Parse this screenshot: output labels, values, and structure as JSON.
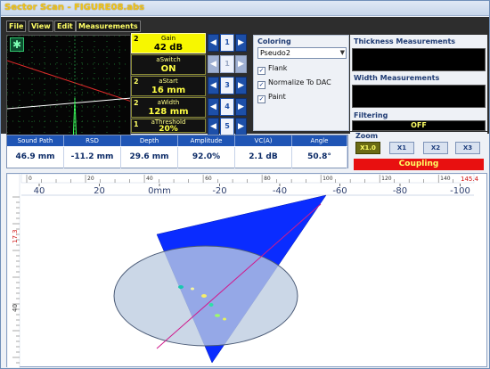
{
  "window": {
    "title": "Sector Scan - FIGURE08.abs"
  },
  "menu": [
    {
      "label": "File"
    },
    {
      "label": "View"
    },
    {
      "label": "Edit"
    },
    {
      "label": "Measurements"
    }
  ],
  "params": [
    {
      "num": "2",
      "label": "Gain",
      "value": "42 dB",
      "selected": true,
      "arrows_disabled": false
    },
    {
      "num": "",
      "label": "aSwitch",
      "value": "ON",
      "selected": false,
      "arrows_disabled": true
    },
    {
      "num": "2",
      "label": "aStart",
      "value": "16 mm",
      "selected": false,
      "arrows_disabled": false
    },
    {
      "num": "2",
      "label": "aWidth",
      "value": "128 mm",
      "selected": false,
      "arrows_disabled": false
    },
    {
      "num": "1",
      "label": "aThreshold",
      "value": "20%",
      "selected": false,
      "arrows_disabled": false
    }
  ],
  "step_icons": [
    "1",
    "1",
    "3",
    "4",
    "5"
  ],
  "coloring": {
    "title": "Coloring",
    "selected": "Pseudo2",
    "checkboxes": [
      {
        "label": "Flank",
        "checked": true
      },
      {
        "label": "Normalize To DAC",
        "checked": true
      },
      {
        "label": "Paint",
        "checked": true
      }
    ]
  },
  "thickness": {
    "title": "Thickness Measurements"
  },
  "width_meas": {
    "title": "Width Measurements"
  },
  "filtering": {
    "title": "Filtering",
    "value": "OFF"
  },
  "zoom": {
    "title": "Zoom",
    "buttons": [
      "X1.0",
      "X1",
      "X2",
      "X3"
    ],
    "active_index": 0
  },
  "coupling": "Coupling",
  "measurements": {
    "headers": [
      "Sound Path",
      "RSD",
      "Depth",
      "Amplitude",
      "VC(A)",
      "Angle"
    ],
    "values": [
      "46.9 mm",
      "-11.2 mm",
      "29.6 mm",
      "92.0%",
      "2.1 dB",
      "50.8°"
    ]
  },
  "scan": {
    "top_ruler_labels": [
      "0",
      "20",
      "40",
      "60",
      "80",
      "100",
      "120",
      "140"
    ],
    "top_ruler_end": "145.4",
    "x_axis_labels": [
      "40",
      "20",
      "0mm",
      "-20",
      "-40",
      "-60",
      "-80",
      "-100"
    ],
    "y_axis_marker": "17.3",
    "y_axis_labels": [
      "40"
    ]
  },
  "colors": {
    "sector_fill": "#0a2cff",
    "ellipse_fill": "#bccce0",
    "beam_line": "#d01a8c",
    "gain_highlight": "#f7f700",
    "coupling_bg": "#e81010",
    "header_blue": "#1f55b5"
  }
}
